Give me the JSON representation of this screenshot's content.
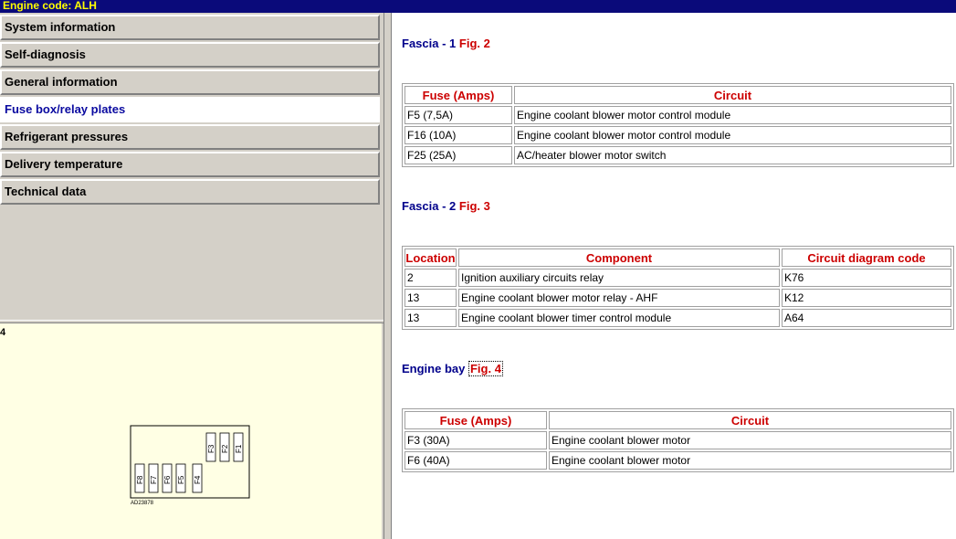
{
  "window": {
    "title": "Engine code: ALH"
  },
  "menu": {
    "items": [
      {
        "label": "System information"
      },
      {
        "label": "Self-diagnosis"
      },
      {
        "label": "General information"
      },
      {
        "label": "Fuse box/relay plates"
      },
      {
        "label": "Refrigerant pressures"
      },
      {
        "label": "Delivery temperature"
      },
      {
        "label": "Technical data"
      }
    ],
    "active_index": 3
  },
  "image_pane": {
    "figure_tag": "4",
    "fuses": [
      "F3",
      "F2",
      "F1",
      "F8",
      "F7",
      "F6",
      "F5",
      "F4"
    ],
    "code": "AD23878"
  },
  "sections": [
    {
      "title": "Fascia",
      "num": " - 1 ",
      "fig": "Fig. 2",
      "headers": [
        "Fuse (Amps)",
        "Circuit"
      ],
      "rows": [
        [
          "F5 (7,5A)",
          "Engine coolant blower motor control module"
        ],
        [
          "F16 (10A)",
          "Engine coolant blower motor control module"
        ],
        [
          "F25 (25A)",
          "AC/heater blower motor switch"
        ]
      ]
    },
    {
      "title": "Fascia",
      "num": " - 2 ",
      "fig": "Fig. 3",
      "headers": [
        "Location",
        "Component",
        "Circuit diagram code"
      ],
      "rows": [
        [
          "2",
          "Ignition auxiliary circuits relay",
          "K76"
        ],
        [
          "13",
          "Engine coolant blower motor relay - AHF",
          "K12"
        ],
        [
          "13",
          "Engine coolant blower timer control module",
          "A64"
        ]
      ]
    },
    {
      "title": "Engine bay",
      "num": " ",
      "fig": "Fig. 4",
      "headers": [
        "Fuse (Amps)",
        "Circuit"
      ],
      "rows": [
        [
          "F3 (30A)",
          "Engine coolant blower motor"
        ],
        [
          "F6 (40A)",
          "Engine coolant blower motor"
        ]
      ]
    }
  ],
  "colors": {
    "title_bar": "#0a0a7a",
    "title_text": "#ffff00",
    "heading": "#00008b",
    "table_header": "#cc0000",
    "image_bg": "#ffffe4"
  }
}
